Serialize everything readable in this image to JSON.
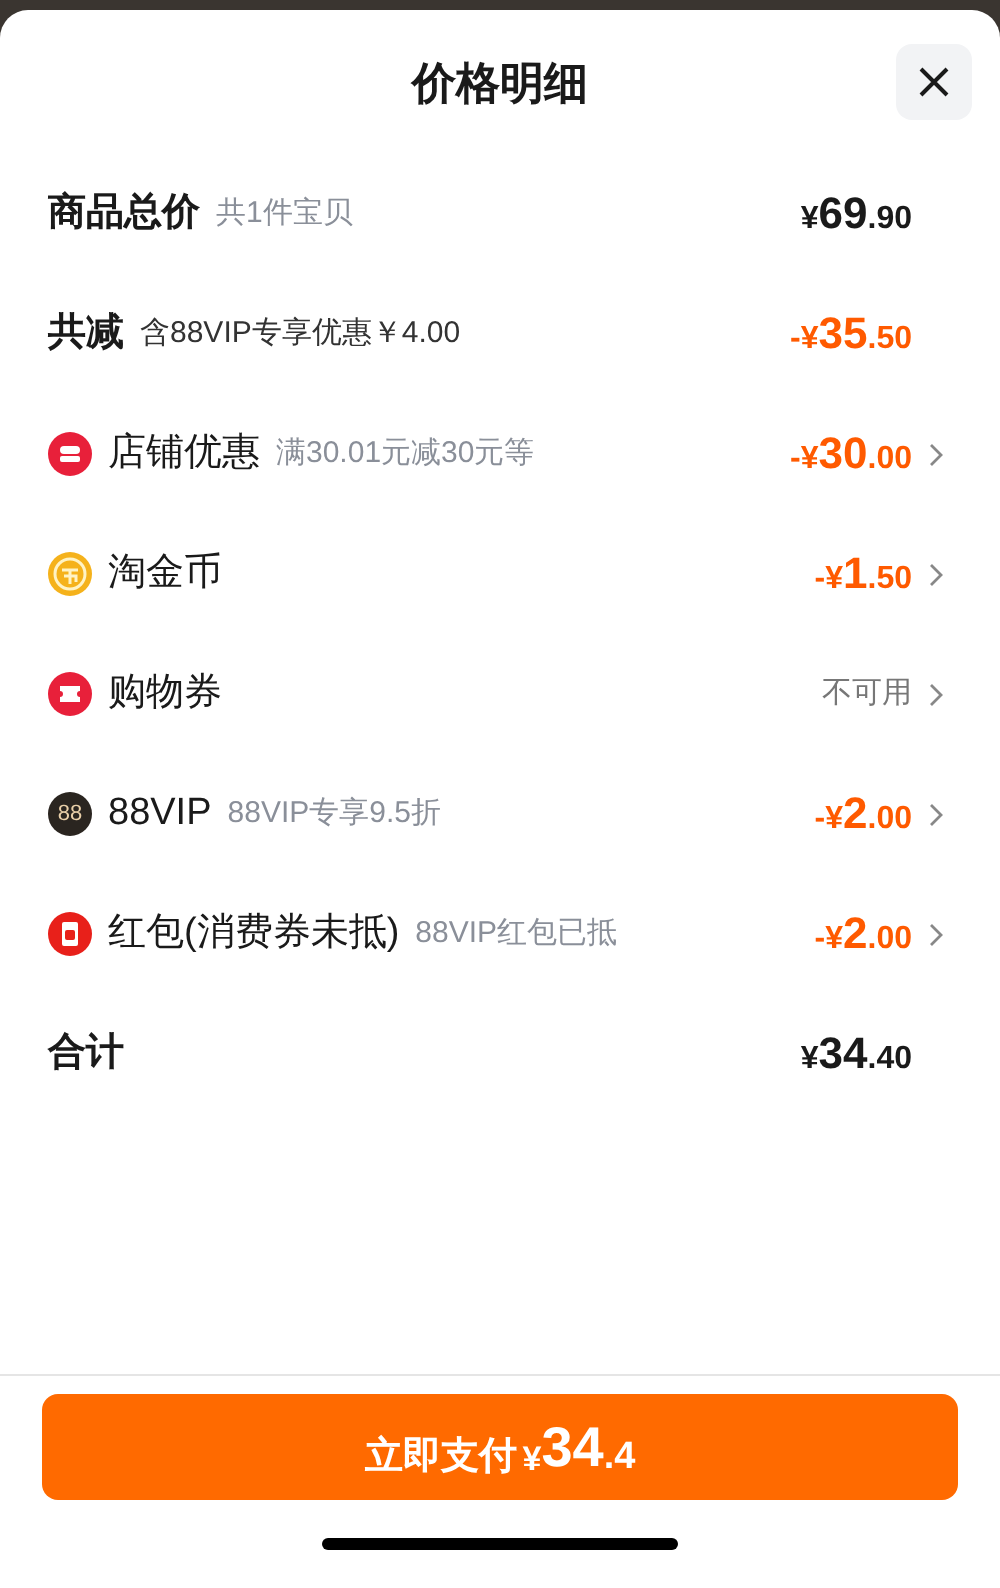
{
  "sheet": {
    "title": "价格明细"
  },
  "rows": [
    {
      "kind": "summary",
      "label": "商品总价",
      "note": "共1件宝贝",
      "price": {
        "sign": "¥",
        "whole": "69",
        "fraction": ".90",
        "discount": false
      }
    },
    {
      "kind": "summary",
      "label": "共减",
      "note": "含88VIP专享优惠￥4.00",
      "price": {
        "sign": "-¥",
        "whole": "35",
        "fraction": ".50",
        "discount": true
      }
    },
    {
      "kind": "shop",
      "label": "店铺优惠",
      "note": "满30.01元减30元等",
      "price": {
        "sign": "-¥",
        "whole": "30",
        "fraction": ".00",
        "discount": true
      }
    },
    {
      "kind": "coin",
      "label": "淘金币",
      "price": {
        "sign": "-¥",
        "whole": "1",
        "fraction": ".50",
        "discount": true
      }
    },
    {
      "kind": "ticket",
      "label": "购物券",
      "status": "不可用"
    },
    {
      "kind": "vip",
      "icon_text": "88",
      "label": "88VIP",
      "note": "88VIP专享9.5折",
      "price": {
        "sign": "-¥",
        "whole": "2",
        "fraction": ".00",
        "discount": true
      }
    },
    {
      "kind": "packet",
      "label": "红包(消费券未抵)",
      "note": "88VIP红包已抵",
      "price": {
        "sign": "-¥",
        "whole": "2",
        "fraction": ".00",
        "discount": true
      }
    },
    {
      "kind": "summary",
      "label": "合计",
      "price": {
        "sign": "¥",
        "whole": "34",
        "fraction": ".40",
        "discount": false
      }
    }
  ],
  "pay_button": {
    "label": "立即支付",
    "sign": "¥",
    "whole": "34",
    "fraction": ".4"
  }
}
